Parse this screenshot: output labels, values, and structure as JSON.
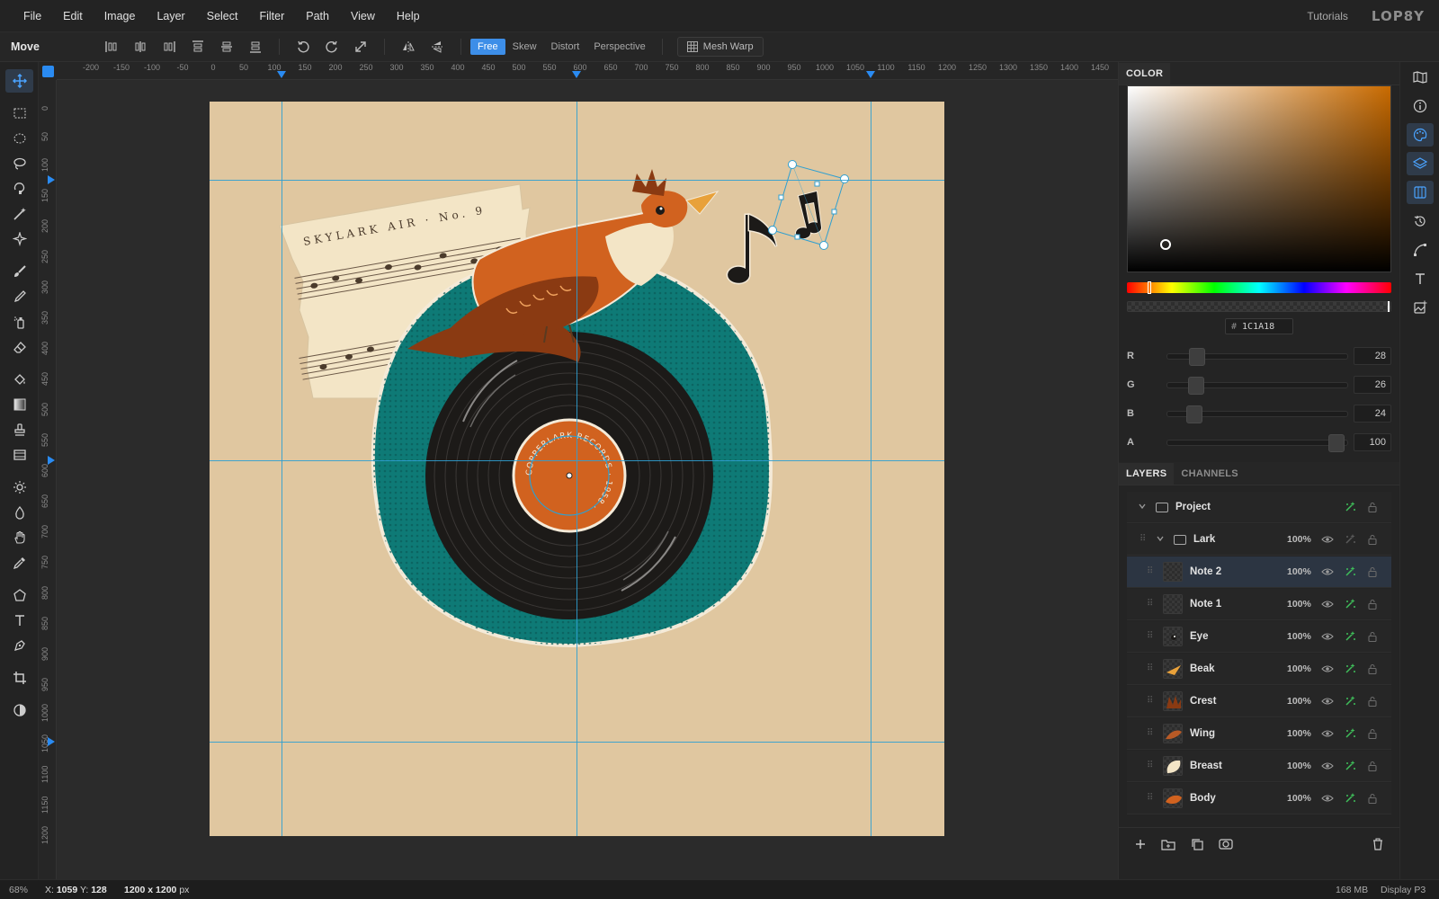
{
  "menu": [
    "File",
    "Edit",
    "Image",
    "Layer",
    "Select",
    "Filter",
    "Path",
    "View",
    "Help"
  ],
  "top_right": {
    "tutorials": "Tutorials",
    "brand": "LOP8Y"
  },
  "options": {
    "tool_name": "Move",
    "modes": [
      "Free",
      "Skew",
      "Distort",
      "Perspective"
    ],
    "active_mode": "Free",
    "mesh_warp": "Mesh Warp"
  },
  "rulers": {
    "top": [
      "-200",
      "-150",
      "-100",
      "-50",
      "0",
      "50",
      "100",
      "150",
      "200",
      "250",
      "300",
      "350",
      "400",
      "450",
      "500",
      "550",
      "600",
      "650",
      "700",
      "750",
      "800",
      "850",
      "900",
      "950",
      "1000",
      "1050",
      "1100",
      "1150",
      "1200",
      "1250",
      "1300",
      "1350",
      "1400",
      "1450"
    ],
    "left": [
      "0",
      "50",
      "100",
      "150",
      "200",
      "250",
      "300",
      "350",
      "400",
      "450",
      "500",
      "550",
      "600",
      "650",
      "700",
      "750",
      "800",
      "850",
      "900",
      "950",
      "1000",
      "1050",
      "1100",
      "1150",
      "1200"
    ]
  },
  "artwork": {
    "sheet_title": "SKYLARK AIR · No. 9",
    "record_label_text": "COPPERLARK RECORDS · 1958 ·"
  },
  "color_panel": {
    "tab": "COLOR",
    "hex_prefix": "#",
    "hex": "1C1A18",
    "hue": 30,
    "channels": [
      {
        "label": "R",
        "value": "28",
        "max": 255
      },
      {
        "label": "G",
        "value": "26",
        "max": 255
      },
      {
        "label": "B",
        "value": "24",
        "max": 255
      },
      {
        "label": "A",
        "value": "100",
        "max": 100
      }
    ]
  },
  "layers_panel": {
    "tabs": [
      "LAYERS",
      "CHANNELS"
    ],
    "active_tab": "LAYERS",
    "layers": [
      {
        "name": "Project",
        "type": "group",
        "depth": 0,
        "opacity": "",
        "expanded": true,
        "thumb": ""
      },
      {
        "name": "Lark",
        "type": "group",
        "depth": 1,
        "opacity": "100%",
        "expanded": true,
        "thumb": ""
      },
      {
        "name": "Note 2",
        "type": "layer",
        "depth": 2,
        "opacity": "100%",
        "selected": true,
        "thumb": "empty"
      },
      {
        "name": "Note 1",
        "type": "layer",
        "depth": 2,
        "opacity": "100%",
        "thumb": "empty"
      },
      {
        "name": "Eye",
        "type": "layer",
        "depth": 2,
        "opacity": "100%",
        "thumb": "eye"
      },
      {
        "name": "Beak",
        "type": "layer",
        "depth": 2,
        "opacity": "100%",
        "thumb": "beak"
      },
      {
        "name": "Crest",
        "type": "layer",
        "depth": 2,
        "opacity": "100%",
        "thumb": "crest"
      },
      {
        "name": "Wing",
        "type": "layer",
        "depth": 2,
        "opacity": "100%",
        "thumb": "wing"
      },
      {
        "name": "Breast",
        "type": "layer",
        "depth": 2,
        "opacity": "100%",
        "thumb": "breast"
      },
      {
        "name": "Body",
        "type": "layer",
        "depth": 2,
        "opacity": "100%",
        "thumb": "body"
      }
    ]
  },
  "status": {
    "zoom": "68%",
    "x_label": "X:",
    "x": "1059",
    "y_label": "Y:",
    "y": "128",
    "size": "1200 x 1200",
    "size_unit": "px",
    "memory": "168 MB",
    "profile": "Display P3"
  },
  "colors": {
    "accent": "#2a8bf2",
    "guide": "#2f9fd0",
    "canvas_bg": "#e0c7a0",
    "teal": "#0e7a76",
    "orange": "#d1621f"
  }
}
